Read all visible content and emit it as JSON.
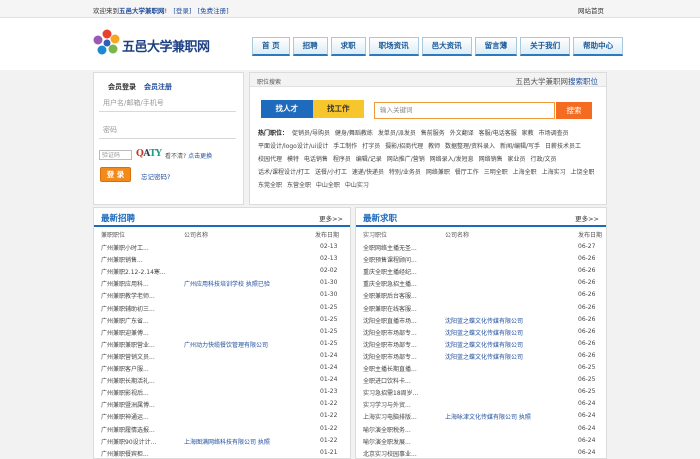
{
  "topbar": {
    "welcome_prefix": "欢迎来到",
    "site_name": "五邑大学兼职网",
    "welcome_suffix": "!",
    "login_link": "[登录]",
    "register_link": "[免费注册]",
    "home_link": "网站首页"
  },
  "header": {
    "logo_text": "五邑大学兼职网",
    "nav": [
      "首 页",
      "招聘",
      "求职",
      "职场资讯",
      "邑大资讯",
      "留言薄",
      "关于我们",
      "帮助中心"
    ]
  },
  "login": {
    "tab_member": "会员登录",
    "tab_register": "会员注册",
    "username_placeholder": "用户名/邮箱/手机号",
    "password_placeholder": "密码",
    "captcha_placeholder": "验证码",
    "captcha_chars": [
      "Q",
      "A",
      "TY"
    ],
    "captcha_unclear": "看不清?",
    "captcha_refresh": "点击更换",
    "login_button": "登 录",
    "forgot_link": "忘记密码?"
  },
  "search": {
    "header_label": "职位搜索",
    "header_site": "五邑大学兼职网",
    "header_suffix": "搜索职位",
    "switch_talent": "找人才",
    "switch_job": "找工作",
    "keyword_placeholder": "输入关键词",
    "button": "搜索",
    "hot_label": "热门职位：",
    "hot_jobs": [
      "促销员/导购员",
      "健身/舞蹈教练",
      "发单员/派发员",
      "售前服务",
      "外文翻译",
      "客服/电话客服",
      "家教",
      "市场调查员",
      "平面设计/logo设计/ui设计",
      "手工制作",
      "打字员",
      "摄影/招商代理",
      "教师",
      "数据整理/资料录入",
      "新闻/编辑/写手",
      "日薪技术员工",
      "校园代理",
      "模特",
      "电话销售",
      "程序员",
      "编辑/记录",
      "网站推广/营销",
      "网络录入/发短息",
      "网络销售",
      "家业员",
      "行政/文员",
      "话术/课程设计/打工",
      "送餐/小打工",
      "速递/快递员",
      "特别/业务员",
      "网络兼职",
      "餐厅工作",
      "三明全职",
      "上海全职",
      "上海实习",
      "上饶全职",
      "东莞全职",
      "东营全职",
      "中山全职",
      "中山实习"
    ]
  },
  "recruit": {
    "title": "最新招聘",
    "more": "更多>>",
    "columns": [
      "兼职职位",
      "公司名称",
      "发布日期"
    ],
    "rows": [
      {
        "job": "广州兼职小时工...",
        "company": "",
        "date": "02-13"
      },
      {
        "job": "广州兼职销售...",
        "company": "",
        "date": "02-13"
      },
      {
        "job": "广州兼职2.12-2.14寒...",
        "company": "",
        "date": "02-02"
      },
      {
        "job": "广州兼职应用科...",
        "company": "广州应用科技培训学校 执照已验",
        "date": "01-30"
      },
      {
        "job": "广州兼职教学老师...",
        "company": "",
        "date": "01-30"
      },
      {
        "job": "广州兼职辅助初三...",
        "company": "",
        "date": "01-25"
      },
      {
        "job": "广州兼职广东省...",
        "company": "",
        "date": "01-25"
      },
      {
        "job": "广州兼职迎兼傅...",
        "company": "",
        "date": "01-25"
      },
      {
        "job": "广州兼职兼职营业...",
        "company": "广州动力快缆餐饮管理有限公司",
        "date": "01-25"
      },
      {
        "job": "广州兼职营销文员...",
        "company": "",
        "date": "01-24"
      },
      {
        "job": "广州兼职客户服...",
        "company": "",
        "date": "01-24"
      },
      {
        "job": "广州兼职长期活礼...",
        "company": "",
        "date": "01-24"
      },
      {
        "job": "广州兼职影视后...",
        "company": "",
        "date": "01-23"
      },
      {
        "job": "广州兼职暨洲属博...",
        "company": "",
        "date": "01-22"
      },
      {
        "job": "广州兼职神通运...",
        "company": "",
        "date": "01-22"
      },
      {
        "job": "广州兼职履情选报...",
        "company": "",
        "date": "01-22"
      },
      {
        "job": "广州兼职90设计计...",
        "company": "上海图满网络科技有限公司 执照",
        "date": "01-22"
      },
      {
        "job": "广州兼职餐宾柜...",
        "company": "",
        "date": "01-21"
      }
    ]
  },
  "seek": {
    "title": "最新求职",
    "more": "更多>>",
    "columns": [
      "实习职位",
      "公司名称",
      "发布日期"
    ],
    "rows": [
      {
        "job": "全职网络主播无圣...",
        "company": "",
        "date": "06-27"
      },
      {
        "job": "全职预售课程顾问...",
        "company": "",
        "date": "06-26"
      },
      {
        "job": "重庆全职主播经纪...",
        "company": "",
        "date": "06-26"
      },
      {
        "job": "重庆全职急招主播...",
        "company": "",
        "date": "06-26"
      },
      {
        "job": "全职兼职后台客服...",
        "company": "",
        "date": "06-26"
      },
      {
        "job": "全职兼职在线客服...",
        "company": "",
        "date": "06-26"
      },
      {
        "job": "沈阳全职直播市场...",
        "company": "沈阳蓝之蝶文化传媒有限公司",
        "date": "06-26"
      },
      {
        "job": "沈阳全职市场部专...",
        "company": "沈阳蓝之蝶文化传媒有限公司",
        "date": "06-26"
      },
      {
        "job": "沈阳全职市场部专...",
        "company": "沈阳蓝之蝶文化传媒有限公司",
        "date": "06-26"
      },
      {
        "job": "沈阳全职市场部专...",
        "company": "沈阳蓝之蝶文化传媒有限公司",
        "date": "06-26"
      },
      {
        "job": "全职主播长期直播...",
        "company": "",
        "date": "06-25"
      },
      {
        "job": "全职进口饮料卡...",
        "company": "",
        "date": "06-25"
      },
      {
        "job": "实习急招需18周岁...",
        "company": "",
        "date": "06-25"
      },
      {
        "job": "实习学习与外贸...",
        "company": "",
        "date": "06-24"
      },
      {
        "job": "上海实习电脑排版...",
        "company": "上海咏津文化传媒有限公司 执照",
        "date": "06-24"
      },
      {
        "job": "喻尔演全职税务...",
        "company": "",
        "date": "06-24"
      },
      {
        "job": "喻尔演全职发展...",
        "company": "",
        "date": "06-24"
      },
      {
        "job": "北京实习校园事业...",
        "company": "",
        "date": "06-24"
      },
      {
        "job": "厦门全职网络主播...",
        "company": "厦门心怡文化传媒有限公司 执照",
        "date": "06-24"
      }
    ]
  }
}
